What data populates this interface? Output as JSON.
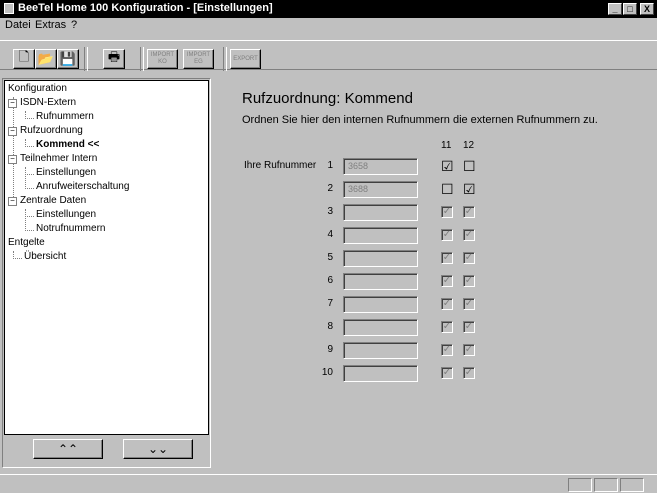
{
  "window": {
    "title": "BeeTel Home 100 Konfiguration - [Einstellungen]",
    "controls": [
      "_",
      "□",
      "X"
    ]
  },
  "menu": [
    {
      "label": "Datei"
    },
    {
      "label": "Extras"
    },
    {
      "label": "?"
    }
  ],
  "toolbar": {
    "buttons": [
      {
        "icon": "new-document-icon",
        "glyph": "🗋"
      },
      {
        "icon": "open-folder-icon",
        "glyph": "📂"
      },
      {
        "icon": "save-disk-icon",
        "glyph": "💾"
      },
      {
        "icon": "print-icon",
        "glyph": "🖶"
      }
    ],
    "disabled_buttons": [
      {
        "line1": "IMPORT",
        "line2": "KO"
      },
      {
        "line1": "IMPORT",
        "line2": "EG"
      },
      {
        "line1": "EXPORT",
        "line2": ""
      }
    ]
  },
  "tree": {
    "items": [
      {
        "label": "Konfiguration"
      },
      {
        "label": "ISDN-Extern",
        "expander": "−"
      },
      {
        "label": "Rufnummern"
      },
      {
        "label": "Rufzuordnung",
        "expander": "−"
      },
      {
        "label": "Kommend <<",
        "selected": true
      },
      {
        "label": "Teilnehmer Intern",
        "expander": "−"
      },
      {
        "label": "Einstellungen"
      },
      {
        "label": "Anrufweiterschaltung"
      },
      {
        "label": "Zentrale Daten",
        "expander": "−"
      },
      {
        "label": "Einstellungen"
      },
      {
        "label": "Notrufnummern"
      },
      {
        "label": "Entgelte"
      },
      {
        "label": "Übersicht"
      }
    ],
    "nav_up": "⌃⌃",
    "nav_down": "⌄⌄"
  },
  "main": {
    "heading": "Rufzuordnung: Kommend",
    "description": "Ordnen Sie hier den internen Rufnummern die externen Rufnummern zu.",
    "col_headers": [
      "11",
      "12"
    ],
    "row_label": "Ihre Rufnummer",
    "rows": [
      {
        "num": "1",
        "value": "3658",
        "c11": "☑",
        "c12": "☐",
        "enabled": true,
        "checked11": true,
        "checked12": false
      },
      {
        "num": "2",
        "value": "3688",
        "c11": "☐",
        "c12": "☑",
        "enabled": true,
        "checked11": false,
        "checked12": true
      },
      {
        "num": "3",
        "value": "",
        "enabled": false
      },
      {
        "num": "4",
        "value": "",
        "enabled": false
      },
      {
        "num": "5",
        "value": "",
        "enabled": false
      },
      {
        "num": "6",
        "value": "",
        "enabled": false
      },
      {
        "num": "7",
        "value": "",
        "enabled": false
      },
      {
        "num": "8",
        "value": "",
        "enabled": false
      },
      {
        "num": "9",
        "value": "",
        "enabled": false
      },
      {
        "num": "10",
        "value": "",
        "enabled": false
      }
    ]
  }
}
